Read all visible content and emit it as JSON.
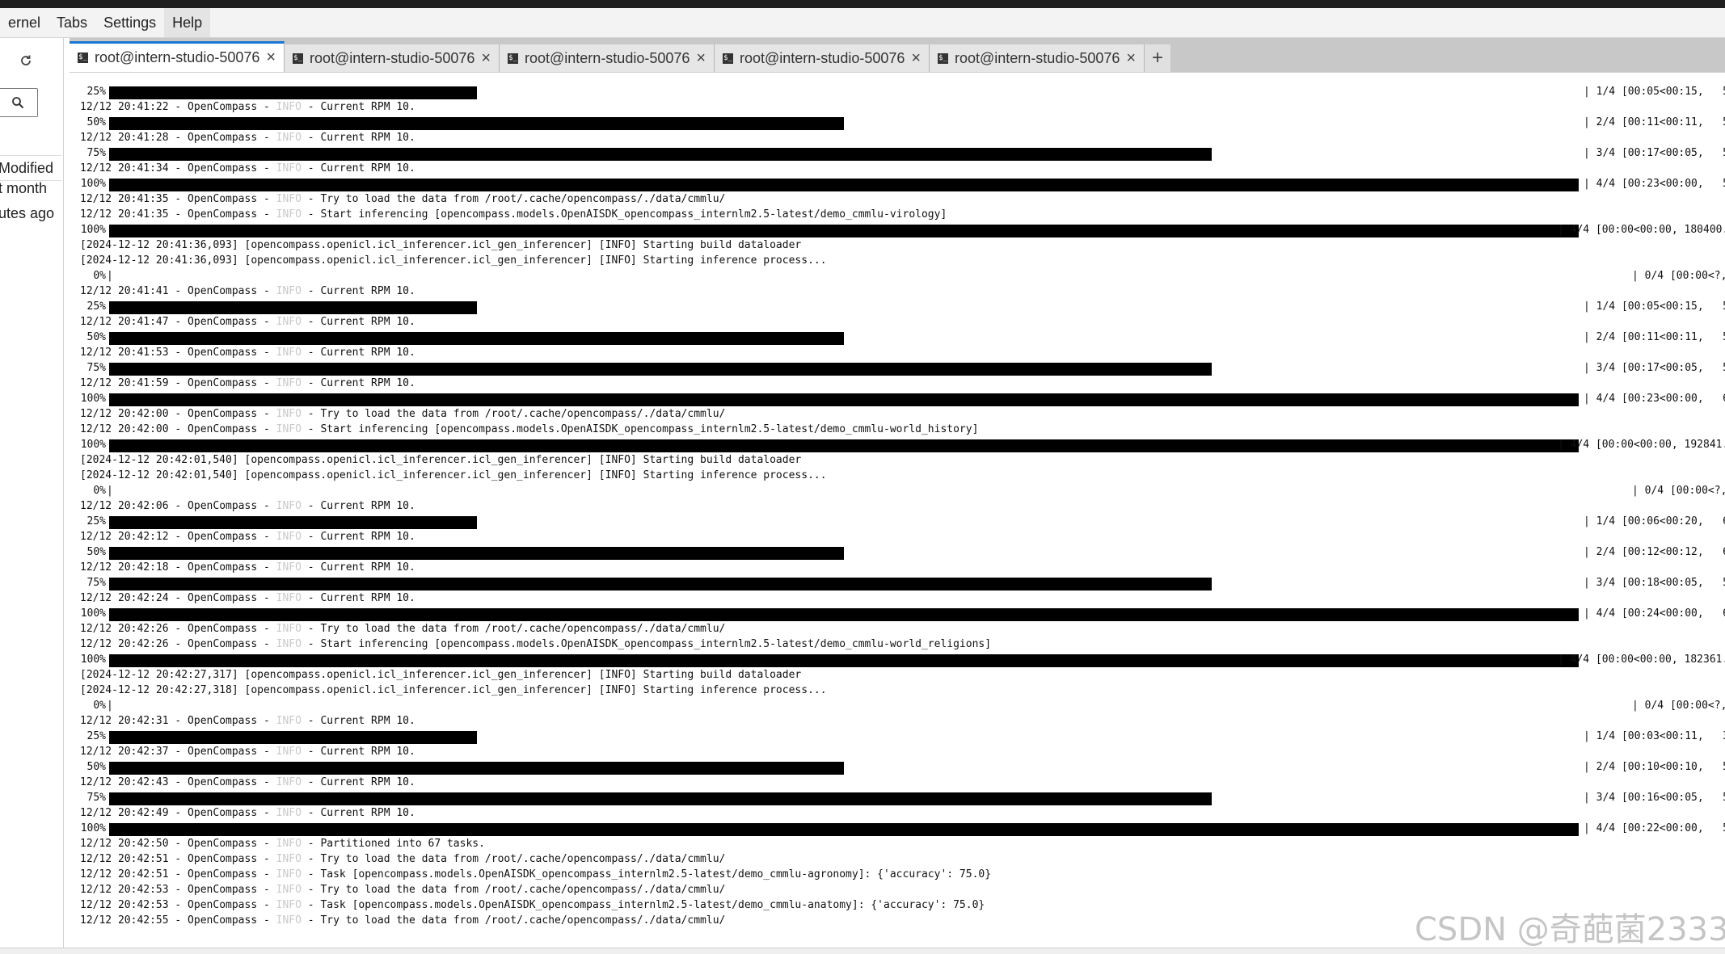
{
  "menu": [
    "ernel",
    "Tabs",
    "Settings",
    "Help"
  ],
  "sidebar": {
    "refresh_icon": "refresh-icon",
    "search_icon": "search-icon",
    "column_modified": "Modified",
    "rows": [
      "t month",
      "utes ago"
    ]
  },
  "tabs": [
    {
      "label": "root@intern-studio-50076",
      "active": true
    },
    {
      "label": "root@intern-studio-50076",
      "active": false
    },
    {
      "label": "root@intern-studio-50076",
      "active": false
    },
    {
      "label": "root@intern-studio-50076",
      "active": false
    },
    {
      "label": "root@intern-studio-50076",
      "active": false
    }
  ],
  "new_tab_label": "+",
  "terminal": [
    {
      "kind": "bar",
      "pct": "25%",
      "fill": 0.25,
      "stat": "| 1/4 [00:05<00:15,   5.",
      "stat_col": "normal"
    },
    {
      "kind": "log",
      "ts": "12/12 20:41:22",
      "msg": "Current RPM 10."
    },
    {
      "kind": "bar",
      "pct": "50%",
      "fill": 0.5,
      "stat": "| 2/4 [00:11<00:11,   5.",
      "stat_col": "normal"
    },
    {
      "kind": "log",
      "ts": "12/12 20:41:28",
      "msg": "Current RPM 10."
    },
    {
      "kind": "bar",
      "pct": "75%",
      "fill": 0.75,
      "stat": "| 3/4 [00:17<00:05,   5.",
      "stat_col": "normal"
    },
    {
      "kind": "log",
      "ts": "12/12 20:41:34",
      "msg": "Current RPM 10."
    },
    {
      "kind": "bar",
      "pct": "100%",
      "fill": 1.0,
      "stat": "| 4/4 [00:23<00:00,   5.",
      "stat_col": "normal"
    },
    {
      "kind": "log",
      "ts": "12/12 20:41:35",
      "msg": "Try to load the data from /root/.cache/opencompass/./data/cmmlu/"
    },
    {
      "kind": "log",
      "ts": "12/12 20:41:35",
      "msg": "Start inferencing [opencompass.models.OpenAISDK_opencompass_internlm2.5-latest/demo_cmmlu-virology]"
    },
    {
      "kind": "bar",
      "pct": "100%",
      "fill": 1.0,
      "stat": "| 4/4 [00:00<00:00, 180400.",
      "stat_col": "wide"
    },
    {
      "kind": "raw",
      "text": "[2024-12-12 20:41:36,093] [opencompass.openicl.icl_inferencer.icl_gen_inferencer] [INFO] Starting build dataloader"
    },
    {
      "kind": "raw",
      "text": "[2024-12-12 20:41:36,093] [opencompass.openicl.icl_inferencer.icl_gen_inferencer] [INFO] Starting inference process..."
    },
    {
      "kind": "bar",
      "pct": "0%",
      "fill": 0,
      "stat": "| 0/4 [00:00<?,",
      "stat_col": "zero"
    },
    {
      "kind": "log",
      "ts": "12/12 20:41:41",
      "msg": "Current RPM 10."
    },
    {
      "kind": "bar",
      "pct": "25%",
      "fill": 0.25,
      "stat": "| 1/4 [00:05<00:15,   5.",
      "stat_col": "normal"
    },
    {
      "kind": "log",
      "ts": "12/12 20:41:47",
      "msg": "Current RPM 10."
    },
    {
      "kind": "bar",
      "pct": "50%",
      "fill": 0.5,
      "stat": "| 2/4 [00:11<00:11,   5.",
      "stat_col": "normal"
    },
    {
      "kind": "log",
      "ts": "12/12 20:41:53",
      "msg": "Current RPM 10."
    },
    {
      "kind": "bar",
      "pct": "75%",
      "fill": 0.75,
      "stat": "| 3/4 [00:17<00:05,   5.",
      "stat_col": "normal"
    },
    {
      "kind": "log",
      "ts": "12/12 20:41:59",
      "msg": "Current RPM 10."
    },
    {
      "kind": "bar",
      "pct": "100%",
      "fill": 1.0,
      "stat": "| 4/4 [00:23<00:00,   6.",
      "stat_col": "normal"
    },
    {
      "kind": "log",
      "ts": "12/12 20:42:00",
      "msg": "Try to load the data from /root/.cache/opencompass/./data/cmmlu/"
    },
    {
      "kind": "log",
      "ts": "12/12 20:42:00",
      "msg": "Start inferencing [opencompass.models.OpenAISDK_opencompass_internlm2.5-latest/demo_cmmlu-world_history]"
    },
    {
      "kind": "bar",
      "pct": "100%",
      "fill": 1.0,
      "stat": "| 4/4 [00:00<00:00, 192841.",
      "stat_col": "wide"
    },
    {
      "kind": "raw",
      "text": "[2024-12-12 20:42:01,540] [opencompass.openicl.icl_inferencer.icl_gen_inferencer] [INFO] Starting build dataloader"
    },
    {
      "kind": "raw",
      "text": "[2024-12-12 20:42:01,540] [opencompass.openicl.icl_inferencer.icl_gen_inferencer] [INFO] Starting inference process..."
    },
    {
      "kind": "bar",
      "pct": "0%",
      "fill": 0,
      "stat": "| 0/4 [00:00<?,",
      "stat_col": "zero"
    },
    {
      "kind": "log",
      "ts": "12/12 20:42:06",
      "msg": "Current RPM 10."
    },
    {
      "kind": "bar",
      "pct": "25%",
      "fill": 0.25,
      "stat": "| 1/4 [00:06<00:20,   6.",
      "stat_col": "normal"
    },
    {
      "kind": "log",
      "ts": "12/12 20:42:12",
      "msg": "Current RPM 10."
    },
    {
      "kind": "bar",
      "pct": "50%",
      "fill": 0.5,
      "stat": "| 2/4 [00:12<00:12,   6.",
      "stat_col": "normal"
    },
    {
      "kind": "log",
      "ts": "12/12 20:42:18",
      "msg": "Current RPM 10."
    },
    {
      "kind": "bar",
      "pct": "75%",
      "fill": 0.75,
      "stat": "| 3/4 [00:18<00:05,   5.",
      "stat_col": "normal"
    },
    {
      "kind": "log",
      "ts": "12/12 20:42:24",
      "msg": "Current RPM 10."
    },
    {
      "kind": "bar",
      "pct": "100%",
      "fill": 1.0,
      "stat": "| 4/4 [00:24<00:00,   6.",
      "stat_col": "normal"
    },
    {
      "kind": "log",
      "ts": "12/12 20:42:26",
      "msg": "Try to load the data from /root/.cache/opencompass/./data/cmmlu/"
    },
    {
      "kind": "log",
      "ts": "12/12 20:42:26",
      "msg": "Start inferencing [opencompass.models.OpenAISDK_opencompass_internlm2.5-latest/demo_cmmlu-world_religions]"
    },
    {
      "kind": "bar",
      "pct": "100%",
      "fill": 1.0,
      "stat": "| 4/4 [00:00<00:00, 182361.",
      "stat_col": "wide"
    },
    {
      "kind": "raw",
      "text": "[2024-12-12 20:42:27,317] [opencompass.openicl.icl_inferencer.icl_gen_inferencer] [INFO] Starting build dataloader"
    },
    {
      "kind": "raw",
      "text": "[2024-12-12 20:42:27,318] [opencompass.openicl.icl_inferencer.icl_gen_inferencer] [INFO] Starting inference process..."
    },
    {
      "kind": "bar",
      "pct": "0%",
      "fill": 0,
      "stat": "| 0/4 [00:00<?,",
      "stat_col": "zero"
    },
    {
      "kind": "log",
      "ts": "12/12 20:42:31",
      "msg": "Current RPM 10."
    },
    {
      "kind": "bar",
      "pct": "25%",
      "fill": 0.25,
      "stat": "| 1/4 [00:03<00:11,   3.",
      "stat_col": "normal"
    },
    {
      "kind": "log",
      "ts": "12/12 20:42:37",
      "msg": "Current RPM 10."
    },
    {
      "kind": "bar",
      "pct": "50%",
      "fill": 0.5,
      "stat": "| 2/4 [00:10<00:10,   5.",
      "stat_col": "normal"
    },
    {
      "kind": "log",
      "ts": "12/12 20:42:43",
      "msg": "Current RPM 10."
    },
    {
      "kind": "bar",
      "pct": "75%",
      "fill": 0.75,
      "stat": "| 3/4 [00:16<00:05,   5.",
      "stat_col": "normal"
    },
    {
      "kind": "log",
      "ts": "12/12 20:42:49",
      "msg": "Current RPM 10."
    },
    {
      "kind": "bar",
      "pct": "100%",
      "fill": 1.0,
      "stat": "| 4/4 [00:22<00:00,   5.",
      "stat_col": "normal"
    },
    {
      "kind": "log",
      "ts": "12/12 20:42:50",
      "msg": "Partitioned into 67 tasks."
    },
    {
      "kind": "log",
      "ts": "12/12 20:42:51",
      "msg": "Try to load the data from /root/.cache/opencompass/./data/cmmlu/"
    },
    {
      "kind": "log",
      "ts": "12/12 20:42:51",
      "msg": "Task [opencompass.models.OpenAISDK_opencompass_internlm2.5-latest/demo_cmmlu-agronomy]: {'accuracy': 75.0}"
    },
    {
      "kind": "log",
      "ts": "12/12 20:42:53",
      "msg": "Try to load the data from /root/.cache/opencompass/./data/cmmlu/"
    },
    {
      "kind": "log",
      "ts": "12/12 20:42:53",
      "msg": "Task [opencompass.models.OpenAISDK_opencompass_internlm2.5-latest/demo_cmmlu-anatomy]: {'accuracy': 75.0}"
    },
    {
      "kind": "log",
      "ts": "12/12 20:42:55",
      "msg": "Try to load the data from /root/.cache/opencompass/./data/cmmlu/"
    }
  ],
  "log_prefix": " - OpenCompass - ",
  "log_level": "INFO",
  "log_sep": " - ",
  "watermark": "CSDN @奇葩菌2333"
}
